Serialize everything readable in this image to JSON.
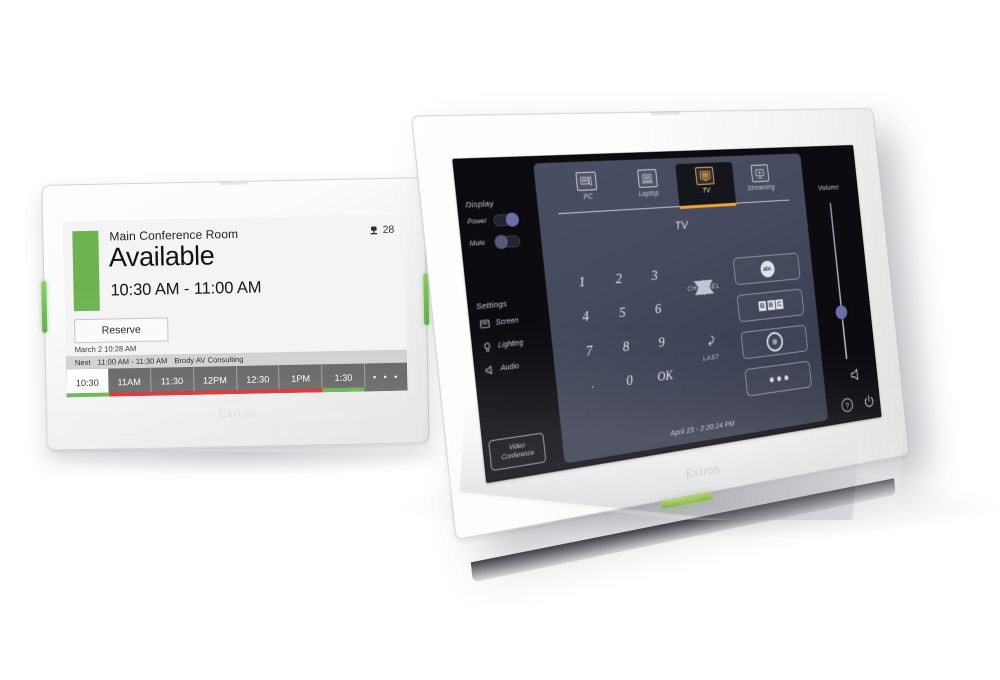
{
  "scene": {
    "background_color": "#ffffff",
    "brand": "Extron"
  },
  "scheduling_panel": {
    "device_label": "room-scheduling-touchpanel",
    "brand": "Extron",
    "status_color": "#6fb351",
    "room_name": "Main Conference Room",
    "status": "Available",
    "time_range": "10:30 AM - 11:00 AM",
    "occupancy": {
      "icon": "occupancy-seat-icon",
      "count": "28"
    },
    "reserve_button": "Reserve",
    "timestamp": "March 2  10:28 AM",
    "next_meeting": {
      "label": "Next",
      "time": "11:00 AM - 11:30 AM",
      "title": "Brody AV Consulting"
    },
    "timeline": {
      "slots": [
        "10:30",
        "11AM",
        "11:30",
        "12PM",
        "12:30",
        "1PM",
        "1:30",
        "• • •"
      ],
      "current_index": 0,
      "availability": [
        {
          "color": "#5fae43",
          "width": 12.5
        },
        {
          "color": "#d81f26",
          "width": 62.5
        },
        {
          "color": "#5fae43",
          "width": 12.5
        },
        {
          "color": "#5e5e5e",
          "width": 12.5
        }
      ]
    }
  },
  "control_panel": {
    "device_label": "av-control-touchpanel",
    "brand": "Extron",
    "accent_color": "#f2a52f",
    "toggle_color": "#6a6fa8",
    "sources": [
      {
        "label": "PC",
        "icon": "desktop-pc-icon",
        "active": false
      },
      {
        "label": "Laptop",
        "icon": "laptop-icon",
        "active": false
      },
      {
        "label": "TV",
        "icon": "tv-icon",
        "active": true
      },
      {
        "label": "Streaming",
        "icon": "streaming-play-icon",
        "active": false
      }
    ],
    "source_title": "TV",
    "display": {
      "header": "Display",
      "controls": [
        {
          "label": "Power",
          "state": "on"
        },
        {
          "label": "Mute",
          "state": "off"
        }
      ]
    },
    "settings": {
      "header": "Settings",
      "items": [
        {
          "label": "Screen",
          "icon": "screen-icon"
        },
        {
          "label": "Lighting",
          "icon": "lightbulb-icon"
        },
        {
          "label": "Audio",
          "icon": "speaker-icon"
        }
      ]
    },
    "video_conference_button": "Video\nConference",
    "video_conference_line1": "Video",
    "video_conference_line2": "Conference",
    "keypad": {
      "rows": [
        [
          "1",
          "2",
          "3"
        ],
        [
          "4",
          "5",
          "6"
        ],
        [
          "7",
          "8",
          "9"
        ],
        [
          ".",
          "0",
          "OK"
        ]
      ]
    },
    "channel": {
      "label": "CHANNEL",
      "up_icon": "triangle-up-icon",
      "down_icon": "triangle-down-icon",
      "last_label": "LAST",
      "last_icon": "undo-arrow-icon"
    },
    "presets": [
      {
        "name": "abc-preset",
        "icon": "abc-logo-icon",
        "text": "abc"
      },
      {
        "name": "bbc-preset",
        "icon": "bbc-logo-icon",
        "letters": [
          "B",
          "B",
          "C"
        ]
      },
      {
        "name": "ring-preset",
        "icon": "ring-logo-icon"
      },
      {
        "name": "more-presets",
        "icon": "more-dots-icon"
      }
    ],
    "volume": {
      "label": "Volume",
      "value_percent": 30,
      "speaker_icon": "speaker-icon"
    },
    "footer": {
      "clock": "April 23 - 2:20:24 PM",
      "help_icon": "help-question-icon",
      "power_icon": "power-icon"
    }
  }
}
